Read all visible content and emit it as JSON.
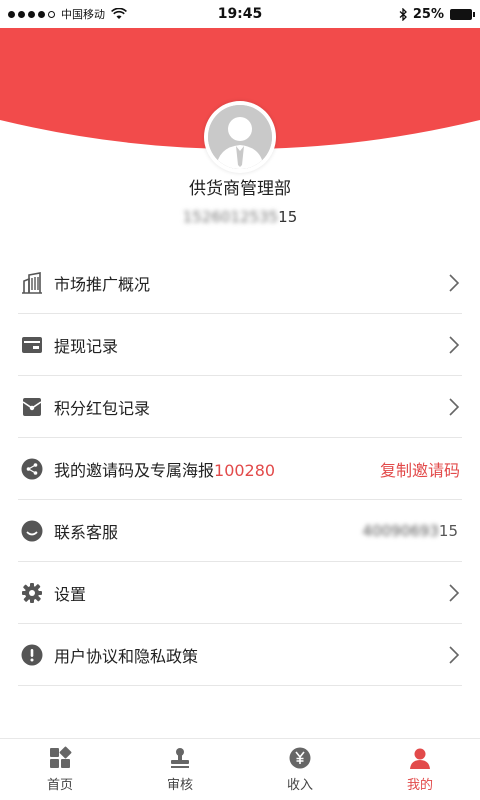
{
  "status_bar": {
    "carrier": "中国移动",
    "time": "19:45",
    "battery": "25%"
  },
  "profile": {
    "name": "供货商管理部",
    "phone_masked": "1526012535",
    "phone_visible": "15"
  },
  "menu": {
    "market": "市场推广概况",
    "withdraw": "提现记录",
    "points": "积分红包记录",
    "invite_label": "我的邀请码及专属海报",
    "invite_code": "100280",
    "invite_action": "复制邀请码",
    "service": "联系客服",
    "service_phone_masked": "40090693",
    "service_phone_visible": "15",
    "settings": "设置",
    "agreement": "用户协议和隐私政策"
  },
  "tabs": {
    "home": "首页",
    "review": "审核",
    "income": "收入",
    "mine": "我的"
  },
  "colors": {
    "accent": "#e24a4a",
    "header": "#f24b4b"
  }
}
